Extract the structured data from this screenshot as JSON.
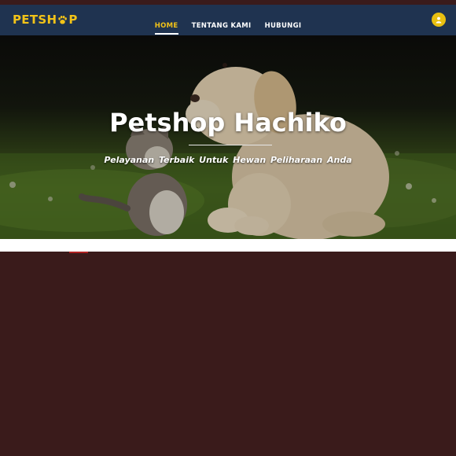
{
  "brand": {
    "name_prefix": "PETSH",
    "name_suffix": "P",
    "icon": "paw-icon",
    "color": "#f2c318"
  },
  "nav": {
    "items": [
      {
        "label": "HOME",
        "active": true
      },
      {
        "label": "TENTANG KAMI",
        "active": false
      },
      {
        "label": "HUBUNGI",
        "active": false
      }
    ]
  },
  "user_button": {
    "icon": "user-icon",
    "color": "#e8bf10"
  },
  "hero": {
    "title": "Petshop Hachiko",
    "subtitle": "Pelayanan Terbaik Untuk Hewan Peliharaan Anda"
  },
  "colors": {
    "navbar": "#1f3350",
    "page_bg": "#3a1b1b",
    "accent": "#f2c318"
  }
}
